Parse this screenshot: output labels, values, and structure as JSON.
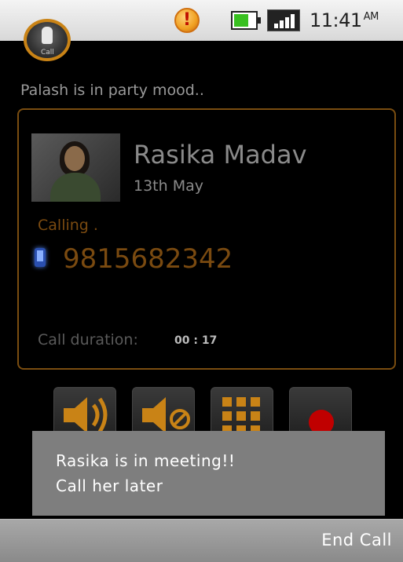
{
  "status_bar": {
    "time": "11:41",
    "ampm": "AM",
    "icons": [
      "alert-icon",
      "battery-icon",
      "signal-icon"
    ],
    "battery_color": "#38c020"
  },
  "app_icon": {
    "label": "Call"
  },
  "mood_text": "Palash is in party mood..",
  "contact": {
    "name": "Rasika Madav",
    "date": "13th May",
    "status": "Calling .",
    "number": "9815682342",
    "duration_label": "Call duration:",
    "duration_value": "00 : 17"
  },
  "controls": [
    {
      "icon": "speaker-icon"
    },
    {
      "icon": "mute-icon"
    },
    {
      "icon": "keypad-icon"
    },
    {
      "icon": "record-icon"
    }
  ],
  "toast": {
    "line1": "Rasika is in meeting!!",
    "line2": "Call her later"
  },
  "bottom_bar": {
    "end_call_label": "End Call"
  },
  "colors": {
    "accent": "#c98316",
    "accent_dim": "#7a4a10",
    "toast_bg": "#7e7e7e",
    "record": "#c00000"
  }
}
